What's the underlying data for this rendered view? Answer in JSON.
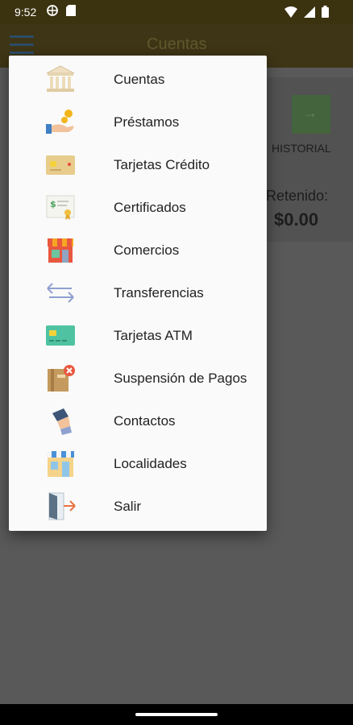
{
  "status": {
    "time": "9:52"
  },
  "app_bar": {
    "title": "Cuentas"
  },
  "background": {
    "history_label": "HISTORIAL",
    "retenido_label": "Retenido:",
    "retenido_value": "$0.00"
  },
  "menu": {
    "items": [
      {
        "label": "Cuentas",
        "icon": "bank-icon"
      },
      {
        "label": "Préstamos",
        "icon": "loan-icon"
      },
      {
        "label": "Tarjetas Crédito",
        "icon": "credit-card-icon"
      },
      {
        "label": "Certificados",
        "icon": "certificate-icon"
      },
      {
        "label": "Comercios",
        "icon": "store-icon"
      },
      {
        "label": "Transferencias",
        "icon": "transfer-arrows-icon"
      },
      {
        "label": "Tarjetas ATM",
        "icon": "atm-card-icon"
      },
      {
        "label": "Suspensión de Pagos",
        "icon": "suspend-payment-icon"
      },
      {
        "label": "Contactos",
        "icon": "contact-icon"
      },
      {
        "label": "Localidades",
        "icon": "building-icon"
      },
      {
        "label": "Salir",
        "icon": "exit-door-icon"
      }
    ]
  }
}
